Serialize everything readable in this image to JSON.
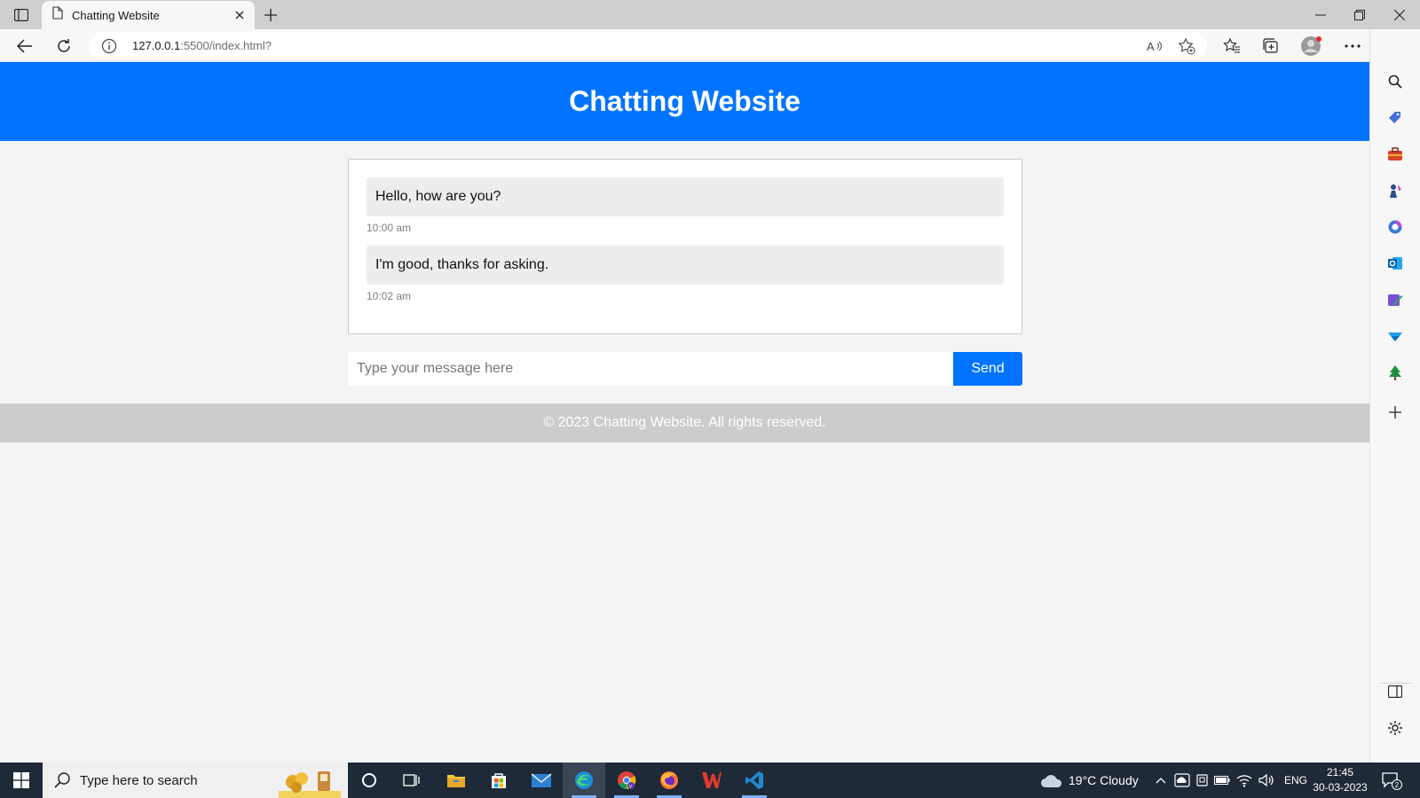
{
  "browser": {
    "tab_title": "Chatting Website",
    "url_host": "127.0.0.1",
    "url_rest": ":5500/index.html?",
    "icons": {
      "tab_actions": "tab-actions-icon",
      "page": "page-icon",
      "close": "close-icon",
      "new_tab": "plus-icon",
      "back": "back-arrow-icon",
      "refresh": "refresh-icon",
      "info": "info-icon",
      "read_aloud": "read-aloud-icon",
      "add_favorite": "star-plus-icon",
      "favorites": "favorites-icon",
      "collections": "collections-icon",
      "profile": "profile-icon",
      "more": "more-icon",
      "bing": "bing-icon"
    },
    "window_controls": [
      "minimize",
      "restore",
      "close"
    ]
  },
  "sidebar": {
    "items": [
      "search-icon",
      "tag-icon",
      "toolbox-icon",
      "games-icon",
      "office-icon",
      "outlook-icon",
      "designer-icon",
      "drop-icon",
      "tree-icon",
      "add-icon"
    ],
    "bottom": [
      "split-screen-icon",
      "settings-icon"
    ]
  },
  "site": {
    "title": "Chatting Website",
    "messages": [
      {
        "text": "Hello, how are you?",
        "time": "10:00 am"
      },
      {
        "text": "I'm good, thanks for asking.",
        "time": "10:02 am"
      }
    ],
    "input_placeholder": "Type your message here",
    "send_label": "Send",
    "footer": "© 2023 Chatting Website. All rights reserved.",
    "colors": {
      "primary": "#0074ff",
      "footer_bg": "#cccccc",
      "page_bg": "#f4f4f4"
    }
  },
  "taskbar": {
    "search_placeholder": "Type here to search",
    "apps": [
      "cortana-icon",
      "task-view-icon",
      "file-explorer-icon",
      "store-icon",
      "mail-icon",
      "edge-icon",
      "chrome-icon",
      "firefox-icon",
      "wps-icon",
      "vscode-icon"
    ],
    "weather": "19°C  Cloudy",
    "language": "ENG",
    "time": "21:45",
    "date": "30-03-2023",
    "notifications": "2"
  }
}
